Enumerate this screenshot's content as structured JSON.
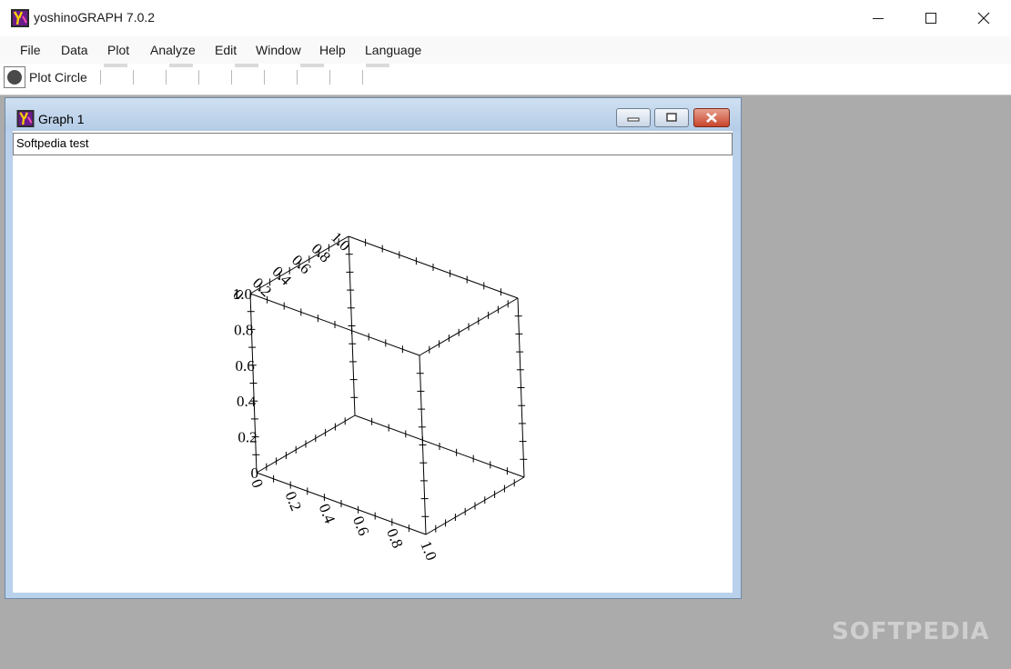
{
  "app": {
    "title": "yoshinoGRAPH 7.0.2"
  },
  "menu": [
    "File",
    "Data",
    "Plot",
    "Analyze",
    "Edit",
    "Window",
    "Help",
    "Language"
  ],
  "toolbar": {
    "plot_label": "Plot Circle"
  },
  "graph_window": {
    "title": "Graph 1",
    "subtitle": "Softpedia test"
  },
  "chart_data": {
    "type": "scatter",
    "projection": "3d-box",
    "x": [],
    "y": [],
    "z": [],
    "xlim": [
      0,
      1
    ],
    "ylim": [
      0,
      1
    ],
    "zlim": [
      0,
      1
    ],
    "xticks": [
      "0",
      "0.2",
      "0.4",
      "0.6",
      "0.8",
      "1.0"
    ],
    "yticks": [
      "0",
      "0.2",
      "0.4",
      "0.6",
      "0.8",
      "1.0"
    ],
    "zticks": [
      "0",
      "0.2",
      "0.4",
      "0.6",
      "0.8",
      "1.0"
    ],
    "grid": false
  },
  "watermark": "SOFTPEDIA",
  "icons": {
    "app": "yoshinograph-logo-icon",
    "minimize": "minimize-icon",
    "maximize": "maximize-icon",
    "close": "close-icon",
    "marker": "filled-circle-icon"
  }
}
